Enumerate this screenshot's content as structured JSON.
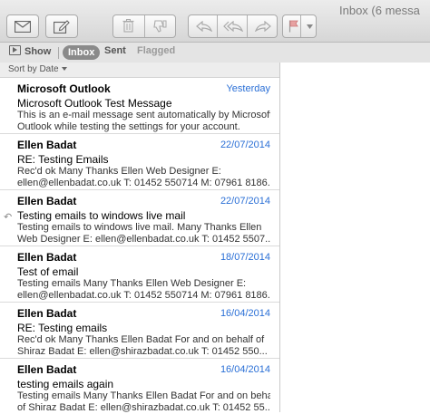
{
  "window": {
    "title": "Inbox (6 messa"
  },
  "toolbar": {
    "buttons": [
      {
        "name": "get-mail",
        "icon": "envelope-icon"
      },
      {
        "name": "compose",
        "icon": "compose-icon"
      },
      {
        "name": "delete",
        "icon": "trash-icon"
      },
      {
        "name": "junk",
        "icon": "thumbs-down-icon"
      },
      {
        "name": "reply",
        "icon": "reply-icon"
      },
      {
        "name": "reply-all",
        "icon": "reply-all-icon"
      },
      {
        "name": "forward",
        "icon": "forward-icon"
      },
      {
        "name": "flag",
        "icon": "flag-icon"
      }
    ]
  },
  "filterbar": {
    "show_label": "Show",
    "inbox_label": "Inbox",
    "sent_label": "Sent",
    "flagged_label": "Flagged"
  },
  "list": {
    "sort_label": "Sort by Date",
    "messages": [
      {
        "sender": "Microsoft Outlook",
        "date": "Yesterday",
        "subject": "Microsoft Outlook Test Message",
        "preview_line1": "This is an e-mail message sent automatically by Microsoft",
        "preview_line2": "Outlook while testing the settings for your account.",
        "replied": false
      },
      {
        "sender": "Ellen Badat",
        "date": "22/07/2014",
        "subject": "RE: Testing Emails",
        "preview_line1": "Rec'd ok Many Thanks Ellen Web Designer E:",
        "preview_line2": "ellen@ellenbadat.co.uk T: 01452 550714 M: 07961 8186...",
        "replied": false
      },
      {
        "sender": "Ellen Badat",
        "date": "22/07/2014",
        "subject": "Testing emails to windows live mail",
        "preview_line1": "Testing emails to windows live mail. Many Thanks Ellen",
        "preview_line2": "Web Designer E: ellen@ellenbadat.co.uk T: 01452 5507...",
        "replied": true
      },
      {
        "sender": "Ellen Badat",
        "date": "18/07/2014",
        "subject": "Test of email",
        "preview_line1": "Testing emails Many Thanks Ellen Web Designer E:",
        "preview_line2": "ellen@ellenbadat.co.uk T: 01452 550714 M: 07961 8186...",
        "replied": false
      },
      {
        "sender": "Ellen Badat",
        "date": "16/04/2014",
        "subject": "RE: Testing emails",
        "preview_line1": "Rec'd ok  Many Thanks     Ellen Badat   For and on behalf of",
        "preview_line2": "Shiraz Badat  E: ellen@shirazbadat.co.uk T: 01452 550...",
        "replied": false
      },
      {
        "sender": "Ellen Badat",
        "date": "16/04/2014",
        "subject": "testing emails again",
        "preview_line1": "Testing emails Many Thanks Ellen Badat For and on behalf",
        "preview_line2": "of Shiraz Badat  E: ellen@shirazbadat.co.uk T: 01452 55...",
        "replied": false
      }
    ]
  },
  "colors": {
    "date_blue": "#2a6fd6",
    "toolbar_top": "#ececec",
    "toolbar_bottom": "#d6d6d6"
  }
}
